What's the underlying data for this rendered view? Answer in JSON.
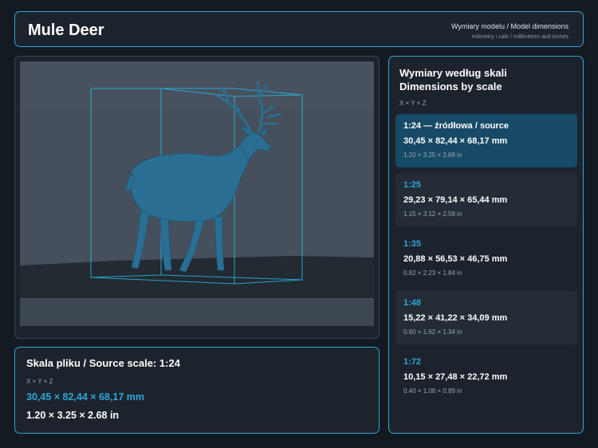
{
  "header": {
    "title": "Mule Deer",
    "subtitle": "Wymiary modelu / Model dimensions",
    "units_note": "milimetry i cale / millimetres and inches"
  },
  "viewport": {
    "model_name": "mule-deer-model",
    "colors": {
      "model": "#2a6f93",
      "bbox": "#29b5e8",
      "wall": "#45505c",
      "floor": "#232a31"
    }
  },
  "source": {
    "title": "Skala pliku / Source scale: 1:24",
    "axes": "X × Y × Z",
    "mm": "30,45 × 82,44 × 68,17 mm",
    "inches": "1.20 × 3.25 × 2.68 in"
  },
  "scales_panel": {
    "title_line1": "Wymiary według skali",
    "title_line2": "Dimensions by scale",
    "axes": "X × Y × Z",
    "rows": [
      {
        "scale": "1:24  —  źródłowa / source",
        "mm": "30,45 × 82,44 × 68,17 mm",
        "inches": "1.20 × 3.25 × 2.68 in",
        "active": true
      },
      {
        "scale": "1:25",
        "mm": "29,23 × 79,14 × 65,44 mm",
        "inches": "1.15 × 3.12 × 2.58 in",
        "active": false
      },
      {
        "scale": "1:35",
        "mm": "20,88 × 56,53 × 46,75 mm",
        "inches": "0.82 × 2.23 × 1.84 in",
        "active": false
      },
      {
        "scale": "1:48",
        "mm": "15,22 × 41,22 × 34,09 mm",
        "inches": "0.60 × 1.62 × 1.34 in",
        "active": false
      },
      {
        "scale": "1:72",
        "mm": "10,15 × 27,48 × 22,72 mm",
        "inches": "0.40 × 1.08 × 0.89 in",
        "active": false
      }
    ]
  },
  "theme": {
    "accent": "#2fa6d9",
    "background": "#141a21",
    "panel": "#1c232c"
  }
}
